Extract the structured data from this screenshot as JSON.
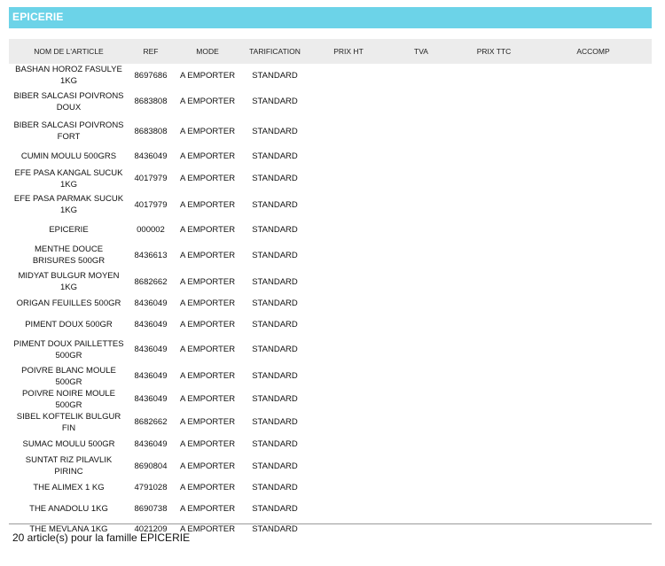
{
  "section": {
    "title": "EPICERIE"
  },
  "columns": [
    "NOM DE L'ARTICLE",
    "REF",
    "MODE",
    "TARIFICATION",
    "PRIX HT",
    "TVA",
    "PRIX TTC",
    "ACCOMP"
  ],
  "rows": [
    {
      "name": "BASHAN  HOROZ FASULYE 1KG",
      "ref": "8697686",
      "mode": "A EMPORTER",
      "tarif": "STANDARD",
      "prix_ht": "",
      "tva": "",
      "prix_ttc": "",
      "accomp": ""
    },
    {
      "name": "BIBER SALCASI  POIVRONS DOUX",
      "ref": "8683808",
      "mode": "A EMPORTER",
      "tarif": "STANDARD",
      "prix_ht": "",
      "tva": "",
      "prix_ttc": "",
      "accomp": ""
    },
    {
      "name": "BIBER SALCASI  POIVRONS FORT",
      "ref": "8683808",
      "mode": "A EMPORTER",
      "tarif": "STANDARD",
      "prix_ht": "",
      "tva": "",
      "prix_ttc": "",
      "accomp": ""
    },
    {
      "name": "CUMIN MOULU 500GRS",
      "ref": "8436049",
      "mode": "A EMPORTER",
      "tarif": "STANDARD",
      "prix_ht": "",
      "tva": "",
      "prix_ttc": "",
      "accomp": ""
    },
    {
      "name": "EFE PASA KANGAL SUCUK  1KG",
      "ref": "4017979",
      "mode": "A EMPORTER",
      "tarif": "STANDARD",
      "prix_ht": "",
      "tva": "",
      "prix_ttc": "",
      "accomp": ""
    },
    {
      "name": "EFE PASA PARMAK SUCUK 1KG",
      "ref": "4017979",
      "mode": "A EMPORTER",
      "tarif": "STANDARD",
      "prix_ht": "",
      "tva": "",
      "prix_ttc": "",
      "accomp": ""
    },
    {
      "name": "EPICERIE",
      "ref": "000002",
      "mode": "A EMPORTER",
      "tarif": "STANDARD",
      "prix_ht": "",
      "tva": "",
      "prix_ttc": "",
      "accomp": ""
    },
    {
      "name": "MENTHE DOUCE BRISURES 500GR",
      "ref": "8436613",
      "mode": "A EMPORTER",
      "tarif": "STANDARD",
      "prix_ht": "",
      "tva": "",
      "prix_ttc": "",
      "accomp": ""
    },
    {
      "name": "MIDYAT BULGUR  MOYEN 1KG",
      "ref": "8682662",
      "mode": "A EMPORTER",
      "tarif": "STANDARD",
      "prix_ht": "",
      "tva": "",
      "prix_ttc": "",
      "accomp": ""
    },
    {
      "name": "ORIGAN FEUILLES 500GR",
      "ref": "8436049",
      "mode": "A EMPORTER",
      "tarif": "STANDARD",
      "prix_ht": "",
      "tva": "",
      "prix_ttc": "",
      "accomp": ""
    },
    {
      "name": "PIMENT DOUX   500GR",
      "ref": "8436049",
      "mode": "A EMPORTER",
      "tarif": "STANDARD",
      "prix_ht": "",
      "tva": "",
      "prix_ttc": "",
      "accomp": ""
    },
    {
      "name": "PIMENT DOUX PAILLETTES 500GR",
      "ref": "8436049",
      "mode": "A EMPORTER",
      "tarif": "STANDARD",
      "prix_ht": "",
      "tva": "",
      "prix_ttc": "",
      "accomp": ""
    },
    {
      "name": "POIVRE BLANC MOULE 500GR",
      "ref": "8436049",
      "mode": "A EMPORTER",
      "tarif": "STANDARD",
      "prix_ht": "",
      "tva": "",
      "prix_ttc": "",
      "accomp": ""
    },
    {
      "name": "POIVRE NOIRE MOULE 500GR",
      "ref": "8436049",
      "mode": "A EMPORTER",
      "tarif": "STANDARD",
      "prix_ht": "",
      "tva": "",
      "prix_ttc": "",
      "accomp": ""
    },
    {
      "name": "SIBEL KOFTELIK BULGUR FIN",
      "ref": "8682662",
      "mode": "A EMPORTER",
      "tarif": "STANDARD",
      "prix_ht": "",
      "tva": "",
      "prix_ttc": "",
      "accomp": ""
    },
    {
      "name": "SUMAC MOULU 500GR",
      "ref": "8436049",
      "mode": "A EMPORTER",
      "tarif": "STANDARD",
      "prix_ht": "",
      "tva": "",
      "prix_ttc": "",
      "accomp": ""
    },
    {
      "name": "SUNTAT RIZ PILAVLIK PIRINC",
      "ref": "8690804",
      "mode": "A EMPORTER",
      "tarif": "STANDARD",
      "prix_ht": "",
      "tva": "",
      "prix_ttc": "",
      "accomp": ""
    },
    {
      "name": "THE ALIMEX 1 KG",
      "ref": "4791028",
      "mode": "A EMPORTER",
      "tarif": "STANDARD",
      "prix_ht": "",
      "tva": "",
      "prix_ttc": "",
      "accomp": ""
    },
    {
      "name": "THE ANADOLU 1KG",
      "ref": "8690738",
      "mode": "A EMPORTER",
      "tarif": "STANDARD",
      "prix_ht": "",
      "tva": "",
      "prix_ttc": "",
      "accomp": ""
    },
    {
      "name": "THE MEVLANA 1KG",
      "ref": "4021209",
      "mode": "A EMPORTER",
      "tarif": "STANDARD",
      "prix_ht": "",
      "tva": "",
      "prix_ttc": "",
      "accomp": ""
    }
  ],
  "footer": {
    "summary": "20 article(s) pour la famille EPICERIE"
  },
  "colors": {
    "header_band": "#6cd3e8",
    "table_header_bg": "#ececec"
  }
}
